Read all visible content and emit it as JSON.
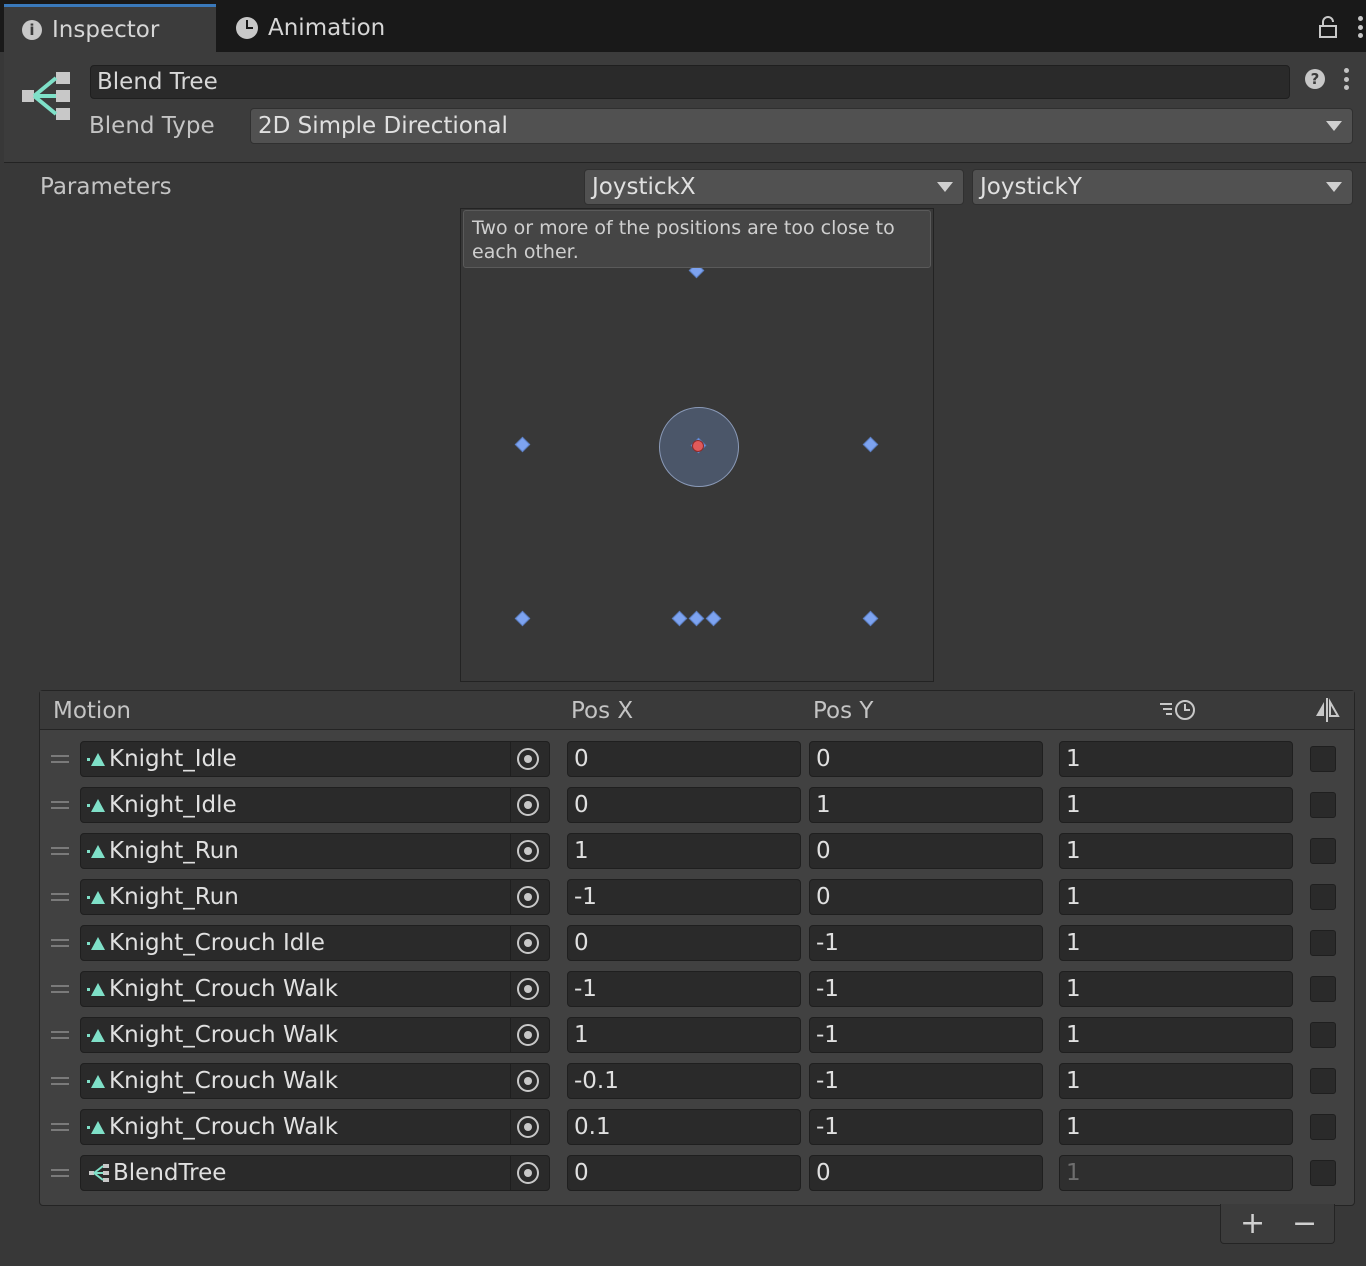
{
  "tabs": [
    {
      "label": "Inspector",
      "icon": "info-icon"
    },
    {
      "label": "Animation",
      "icon": "clock-icon"
    }
  ],
  "header": {
    "name": "Blend Tree",
    "blend_type_label": "Blend Type",
    "blend_type_value": "2D Simple Directional"
  },
  "parameters": {
    "label": "Parameters",
    "x_param": "JoystickX",
    "y_param": "JoystickY"
  },
  "graph": {
    "warning": "Two or more of the positions are too close to each other.",
    "current_position": [
      0,
      0
    ]
  },
  "table": {
    "headers": {
      "motion": "Motion",
      "pos_x": "Pos X",
      "pos_y": "Pos Y",
      "speed_icon": "time-scale-icon",
      "mirror_icon": "mirror-icon"
    },
    "rows": [
      {
        "motion": "Knight_Idle",
        "type": "animation",
        "pos_x": "0",
        "pos_y": "0",
        "speed": "1",
        "mirror": false
      },
      {
        "motion": "Knight_Idle",
        "type": "animation",
        "pos_x": "0",
        "pos_y": "1",
        "speed": "1",
        "mirror": false
      },
      {
        "motion": "Knight_Run",
        "type": "animation",
        "pos_x": "1",
        "pos_y": "0",
        "speed": "1",
        "mirror": false
      },
      {
        "motion": "Knight_Run",
        "type": "animation",
        "pos_x": "-1",
        "pos_y": "0",
        "speed": "1",
        "mirror": false
      },
      {
        "motion": "Knight_Crouch Idle",
        "type": "animation",
        "pos_x": "0",
        "pos_y": "-1",
        "speed": "1",
        "mirror": false
      },
      {
        "motion": "Knight_Crouch Walk",
        "type": "animation",
        "pos_x": "-1",
        "pos_y": "-1",
        "speed": "1",
        "mirror": false
      },
      {
        "motion": "Knight_Crouch Walk",
        "type": "animation",
        "pos_x": "1",
        "pos_y": "-1",
        "speed": "1",
        "mirror": false
      },
      {
        "motion": "Knight_Crouch Walk",
        "type": "animation",
        "pos_x": "-0.1",
        "pos_y": "-1",
        "speed": "1",
        "mirror": false
      },
      {
        "motion": "Knight_Crouch Walk",
        "type": "animation",
        "pos_x": "0.1",
        "pos_y": "-1",
        "speed": "1",
        "mirror": false
      },
      {
        "motion": "BlendTree",
        "type": "blendtree",
        "pos_x": "0",
        "pos_y": "0",
        "speed": "1",
        "mirror": false
      }
    ]
  },
  "footer": {
    "add": "+",
    "remove": "−"
  },
  "colors": {
    "accent": "#3a79bb",
    "point": "#7da3f0",
    "current": "#e05a5a",
    "anim_icon": "#7fe0c8"
  }
}
